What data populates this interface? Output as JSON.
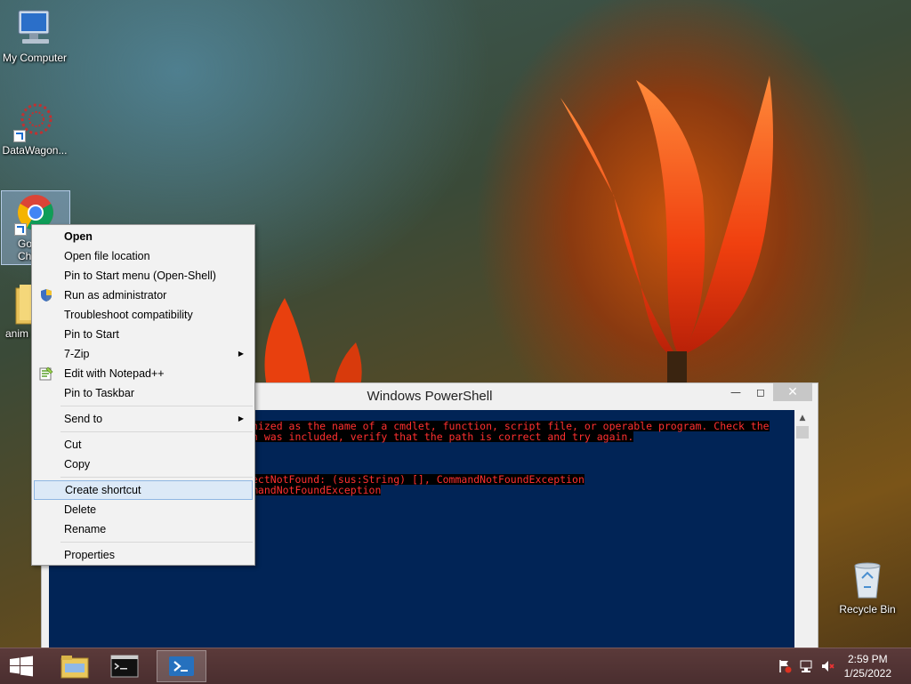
{
  "desktop": {
    "icons": [
      {
        "label": "My Computer"
      },
      {
        "label": "DataWagon..."
      },
      {
        "label": "Go\nChr"
      },
      {
        "label": "anim"
      },
      {
        "label": "Recycle Bin"
      }
    ]
  },
  "powershell": {
    "title": "Windows PowerShell",
    "lines": [
      "nized as the name of a cmdlet, function, script file, or operable program. Check the",
      "n was included, verify that the path is correct and try again.",
      "",
      "",
      "ectNotFound: (sus:String) [], CommandNotFoundException",
      "mandNotFoundException"
    ]
  },
  "context_menu": {
    "items": [
      {
        "label": "Open"
      },
      {
        "label": "Open file location"
      },
      {
        "label": "Pin to Start menu (Open-Shell)"
      },
      {
        "label": "Run as administrator"
      },
      {
        "label": "Troubleshoot compatibility"
      },
      {
        "label": "Pin to Start"
      },
      {
        "label": "7-Zip"
      },
      {
        "label": "Edit with Notepad++"
      },
      {
        "label": "Pin to Taskbar"
      },
      {
        "label": "Send to"
      },
      {
        "label": "Cut"
      },
      {
        "label": "Copy"
      },
      {
        "label": "Create shortcut"
      },
      {
        "label": "Delete"
      },
      {
        "label": "Rename"
      },
      {
        "label": "Properties"
      }
    ]
  },
  "taskbar": {
    "time": "2:59 PM",
    "date": "1/25/2022"
  },
  "colors": {
    "ps_background": "#012456",
    "ps_error_text": "#ff3030",
    "menu_hover": "#dce9f7",
    "taskbar": "#4a2e2f"
  }
}
